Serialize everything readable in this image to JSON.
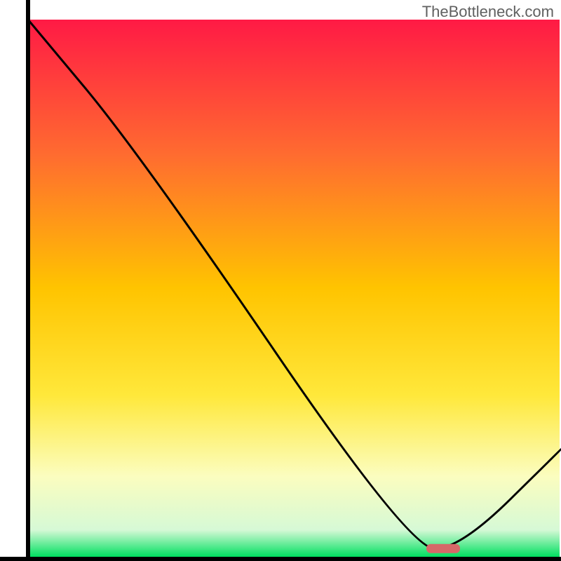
{
  "watermark": "TheBottleneck.com",
  "chart_data": {
    "type": "line",
    "title": "",
    "xlabel": "",
    "ylabel": "",
    "xlim": [
      0,
      100
    ],
    "ylim": [
      0,
      100
    ],
    "series": [
      {
        "name": "curve",
        "x": [
          5,
          25,
          73,
          82,
          100
        ],
        "y": [
          100,
          75,
          1.5,
          1.5,
          20
        ]
      }
    ],
    "marker": {
      "x_center": 79,
      "y": 1.6,
      "width_pct": 6,
      "color": "#d66868"
    },
    "gradient_stops": [
      {
        "offset": 0,
        "color": "#ff1a45"
      },
      {
        "offset": 0.25,
        "color": "#ff6b30"
      },
      {
        "offset": 0.5,
        "color": "#ffc400"
      },
      {
        "offset": 0.7,
        "color": "#ffe83b"
      },
      {
        "offset": 0.85,
        "color": "#fbfdbf"
      },
      {
        "offset": 0.95,
        "color": "#d6f9d6"
      },
      {
        "offset": 1.0,
        "color": "#00e060"
      }
    ],
    "axes": {
      "left": {
        "x1": 5,
        "y1": 0,
        "x2": 5,
        "y2": 100
      },
      "bottom": {
        "x1": 5,
        "y1": 100,
        "x2": 100,
        "y2": 100
      }
    }
  }
}
